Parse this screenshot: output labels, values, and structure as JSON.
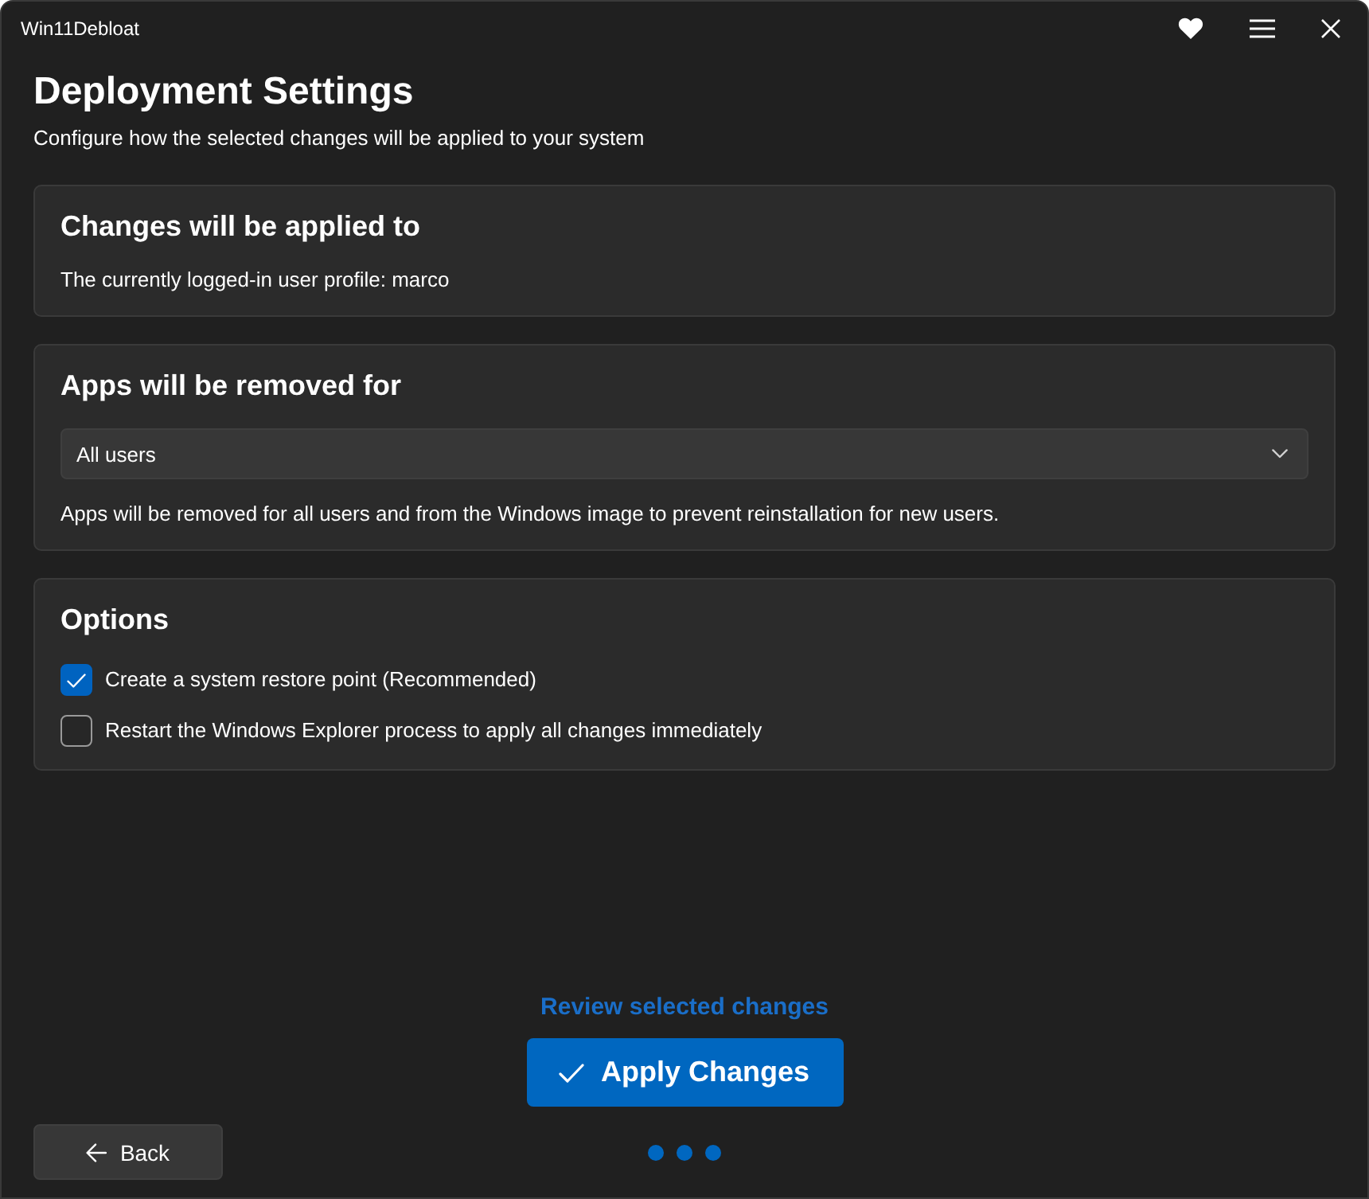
{
  "window": {
    "title": "Win11Debloat"
  },
  "header": {
    "title": "Deployment Settings",
    "subtitle": "Configure how the selected changes will be applied to your system"
  },
  "cards": [
    {
      "kind": "info",
      "title": "Changes will be applied to",
      "text": "The currently logged-in user profile: marco"
    },
    {
      "kind": "dropdown",
      "title": "Apps will be removed for",
      "dropdown": {
        "value": "All users"
      },
      "text": "Apps will be removed for all users and from the Windows image to prevent reinstallation for new users."
    },
    {
      "kind": "options",
      "title": "Options",
      "options": [
        {
          "label": "Create a system restore point (Recommended)",
          "checked": true
        },
        {
          "label": "Restart the Windows Explorer process to apply all changes immediately",
          "checked": false
        }
      ]
    }
  ],
  "footer": {
    "review_link": "Review selected changes",
    "apply_button": "Apply Changes",
    "back_button": "Back",
    "step_dots": [
      {
        "done": true
      },
      {
        "done": true
      },
      {
        "done": true
      }
    ]
  }
}
